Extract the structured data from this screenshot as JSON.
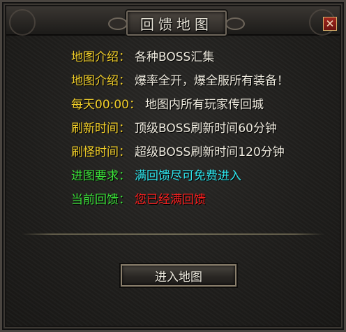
{
  "dialog": {
    "title": "回馈地图",
    "close_icon": "close-icon",
    "rows": [
      {
        "label": "地图介绍：",
        "value": "各种BOSS汇集",
        "label_color": "#f2cf2a",
        "value_color": "#f0ece0"
      },
      {
        "label": "地图介绍：",
        "value": "爆率全开，爆全服所有装备！",
        "label_color": "#f2cf2a",
        "value_color": "#f0ece0"
      },
      {
        "label": "每天00:00：",
        "value": "地图内所有玩家传回城",
        "label_color": "#f2cf2a",
        "value_color": "#f0ece0"
      },
      {
        "label": "刷新时间：",
        "value": "顶级BOSS刷新时间60分钟",
        "label_color": "#f2cf2a",
        "value_color": "#f0ece0"
      },
      {
        "label": "刷怪时间：",
        "value": "超级BOSS刷新时间120分钟",
        "label_color": "#f2cf2a",
        "value_color": "#f0ece0"
      },
      {
        "label": "进图要求：",
        "value": "满回馈尽可免费进入",
        "label_color": "#3ce23a",
        "value_color": "#2ee6ee"
      },
      {
        "label": "当前回馈：",
        "value": "您已经满回馈",
        "label_color": "#3ce23a",
        "value_color": "#ff2020"
      }
    ],
    "enter_button": "进入地图"
  }
}
